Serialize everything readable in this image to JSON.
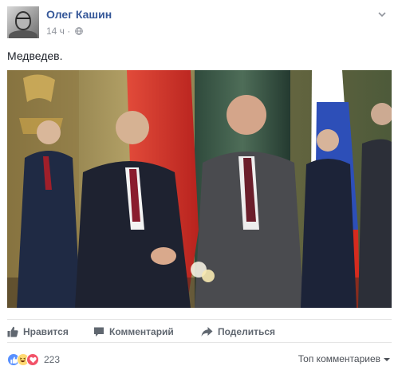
{
  "post": {
    "author": "Олег Кашин",
    "time": "14 ч",
    "separator": "·",
    "text": "Медведев.",
    "visibility_icon": "globe-icon",
    "options_icon": "chevron-down-icon"
  },
  "actions": {
    "like_label": "Нравится",
    "comment_label": "Комментарий",
    "share_label": "Поделиться"
  },
  "reactions": {
    "count": "223",
    "types": [
      "like",
      "haha",
      "love"
    ]
  },
  "comments_filter": {
    "label": "Топ комментариев"
  },
  "colors": {
    "author": "#365899",
    "meta": "#90949c",
    "action": "#606770",
    "like_blue": "#5890ff",
    "love_red": "#f25268"
  }
}
